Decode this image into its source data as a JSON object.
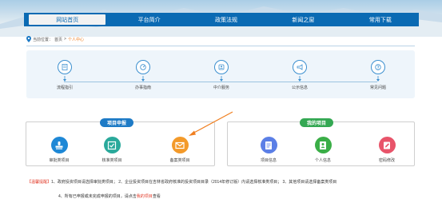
{
  "nav": {
    "items": [
      {
        "label": "网站首页",
        "active": true
      },
      {
        "label": "平台简介",
        "active": false
      },
      {
        "label": "政策法规",
        "active": false
      },
      {
        "label": "新闻之窗",
        "active": false
      },
      {
        "label": "常用下载",
        "active": false
      }
    ]
  },
  "breadcrumb": {
    "prefix": "当前位置：",
    "home": "首页",
    "separator": ">",
    "current": "个人中心"
  },
  "services": [
    {
      "label": "流程指引",
      "icon": "flow-guide-icon"
    },
    {
      "label": "办事指南",
      "icon": "service-guide-icon"
    },
    {
      "label": "中介服务",
      "icon": "agency-service-icon"
    },
    {
      "label": "公示信息",
      "icon": "announcement-icon"
    },
    {
      "label": "常见问题",
      "icon": "question-icon"
    }
  ],
  "project_report": {
    "title": "项目申报",
    "items": [
      {
        "label": "审批类项目",
        "color": "#1e88d6",
        "icon": "stamp-icon"
      },
      {
        "label": "核准类项目",
        "color": "#2aa99b",
        "icon": "check-icon"
      },
      {
        "label": "备案类项目",
        "color": "#f39a2a",
        "icon": "envelope-icon"
      }
    ]
  },
  "my_projects": {
    "title": "我的项目",
    "items": [
      {
        "label": "项目信息",
        "color": "#5b7fe6",
        "icon": "document-icon"
      },
      {
        "label": "个人信息",
        "color": "#3aae47",
        "icon": "id-card-icon"
      },
      {
        "label": "密码修改",
        "color": "#e8546a",
        "icon": "edit-icon"
      }
    ]
  },
  "notes": {
    "label": "【温馨提醒】",
    "text1": "1、政府投资项目请选择审批类项目； 2、企业投资项目在吉林省政府核准的投资项目目录（2014年修订版）内请选择核准类项目； 3、其他项目请选择备案类项目",
    "text2_prefix": "4、所有已申报或未完成申报的项目，请点击",
    "text2_link": "我的项目",
    "text2_suffix": "查看"
  },
  "colors": {
    "nav_blue": "#0a6ab3",
    "accent_orange": "#f07f20",
    "note_red": "#e23c2a"
  }
}
